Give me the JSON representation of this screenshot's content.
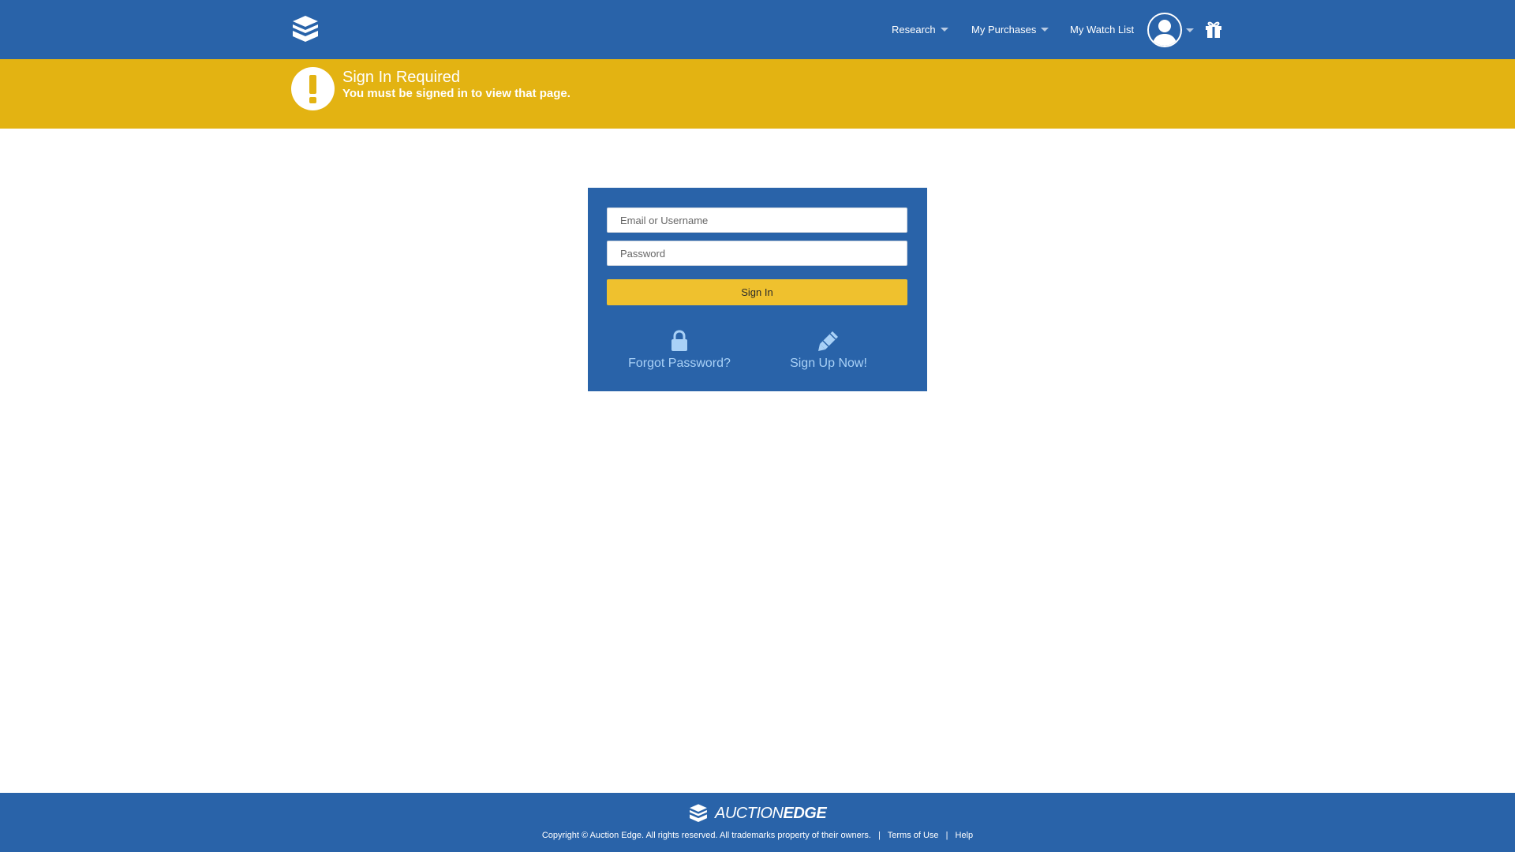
{
  "header": {
    "logo_icon": "auction-edge-cube-icon",
    "nav": {
      "research": "Research",
      "my_purchases": "My Purchases",
      "my_watch_list": "My Watch List"
    },
    "avatar_icon": "user-avatar-icon",
    "gift_icon": "gift-icon",
    "colors": {
      "bar": "#2963a9"
    }
  },
  "alert": {
    "icon": "exclamation-icon",
    "title": "Sign In Required",
    "message": "You must be signed in to view that page.",
    "color": "#e3b312"
  },
  "signin": {
    "email_placeholder": "Email or Username",
    "password_placeholder": "Password",
    "submit_label": "Sign In",
    "forgot_label": "Forgot Password?",
    "forgot_icon": "lock-icon",
    "signup_label": "Sign Up Now!",
    "signup_icon": "pencil-icon",
    "colors": {
      "panel": "#2963a9",
      "button": "#efc12e",
      "link": "#a9d1f7"
    }
  },
  "footer": {
    "brand_a": "AUCTION",
    "brand_b": "EDGE",
    "copyright": "Copyright © Auction Edge. All rights reserved. All trademarks property of their owners.",
    "sep1": "|",
    "terms": "Terms of Use",
    "sep2": "|",
    "help": "Help"
  }
}
